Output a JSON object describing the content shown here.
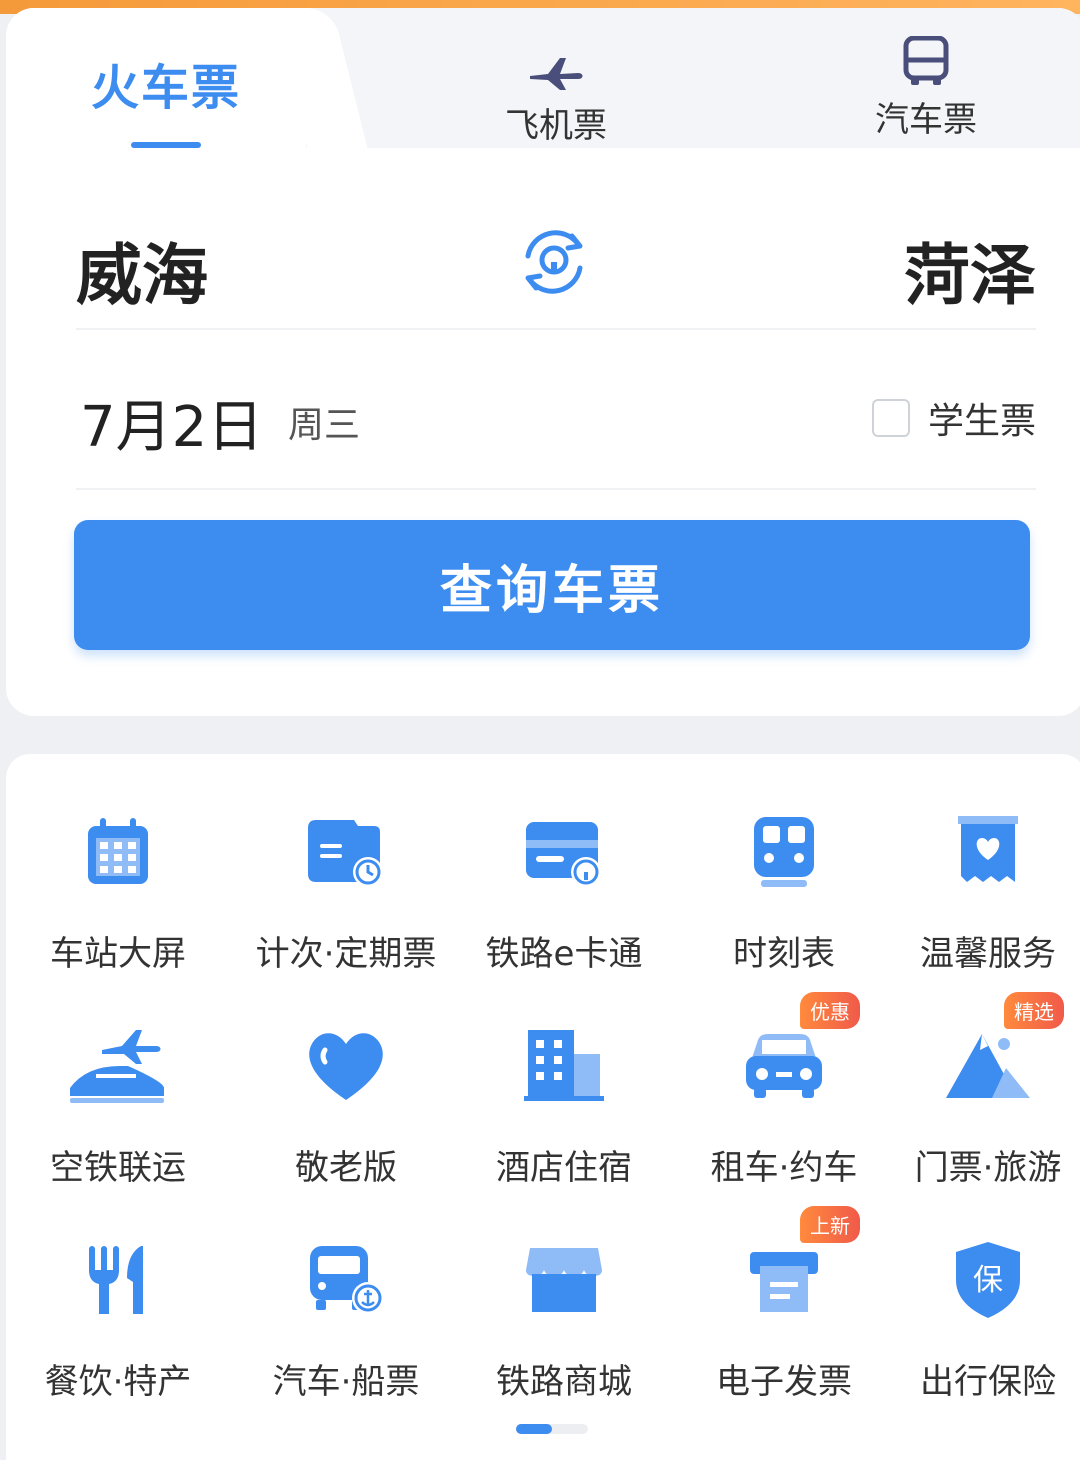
{
  "tabs": {
    "train": "火车票",
    "flight": "飞机票",
    "bus": "汽车票"
  },
  "route": {
    "from": "威海",
    "to": "菏泽"
  },
  "date": {
    "value": "7月2日",
    "weekday": "周三"
  },
  "student_ticket": {
    "label": "学生票",
    "checked": false
  },
  "search_button": "查询车票",
  "services": [
    {
      "label": "车站大屏",
      "icon": "calendar-icon"
    },
    {
      "label": "计次·定期票",
      "icon": "periodic-ticket-icon"
    },
    {
      "label": "铁路e卡通",
      "icon": "e-card-icon"
    },
    {
      "label": "时刻表",
      "icon": "train-schedule-icon"
    },
    {
      "label": "温馨服务",
      "icon": "heart-service-icon"
    },
    {
      "label": "空铁联运",
      "icon": "air-rail-icon"
    },
    {
      "label": "敬老版",
      "icon": "heart-icon"
    },
    {
      "label": "酒店住宿",
      "icon": "hotel-icon"
    },
    {
      "label": "租车·约车",
      "icon": "car-icon",
      "badge": "优惠"
    },
    {
      "label": "门票·旅游",
      "icon": "mountain-icon",
      "badge": "精选"
    },
    {
      "label": "餐饮·特产",
      "icon": "fork-knife-icon"
    },
    {
      "label": "汽车·船票",
      "icon": "bus-ship-icon"
    },
    {
      "label": "铁路商城",
      "icon": "shop-icon"
    },
    {
      "label": "电子发票",
      "icon": "invoice-icon",
      "badge": "上新"
    },
    {
      "label": "出行保险",
      "icon": "insurance-icon"
    }
  ],
  "colors": {
    "accent": "#3d8cf0",
    "badge": "#f05a4a",
    "top_strip": "#f59a3a"
  }
}
